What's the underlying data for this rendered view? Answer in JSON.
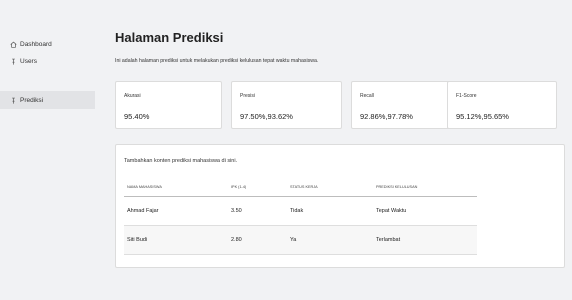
{
  "sidebar": {
    "items": [
      {
        "label": "Dashboard",
        "icon": "home-icon"
      },
      {
        "label": "Users",
        "icon": "pin-icon"
      },
      {
        "label": "Prediksi",
        "icon": "pin-icon",
        "active": true
      }
    ]
  },
  "main": {
    "title": "Halaman Prediksi",
    "subtitle": "Ini adalah halaman prediksi untuk melakukan prediksi kelulusan tepat waktu mahasiswa.",
    "metrics": [
      {
        "label": "Akurasi",
        "value": "95.40%"
      },
      {
        "label": "Presisi",
        "value": "97.50%,93.62%"
      },
      {
        "label": "Recall",
        "value": "92.86%,97.78%"
      },
      {
        "label": "F1-Score",
        "value": "95.12%,95.65%"
      }
    ],
    "panel_note": "Tambahkan konten prediksi mahasiswa di sini.",
    "table": {
      "headers": [
        "Nama Mahasiswa",
        "IPK (1-4)",
        "Status Kerja",
        "Prediksi Kelulusan"
      ],
      "rows": [
        [
          "Ahmad Fajar",
          "3.50",
          "Tidak",
          "Tepat Waktu"
        ],
        [
          "Siti Budi",
          "2.80",
          "Ya",
          "Terlambat"
        ]
      ]
    }
  },
  "colors": {
    "background": "#f1f2f4",
    "card": "#ffffff",
    "active_nav": "#e2e3e6"
  }
}
